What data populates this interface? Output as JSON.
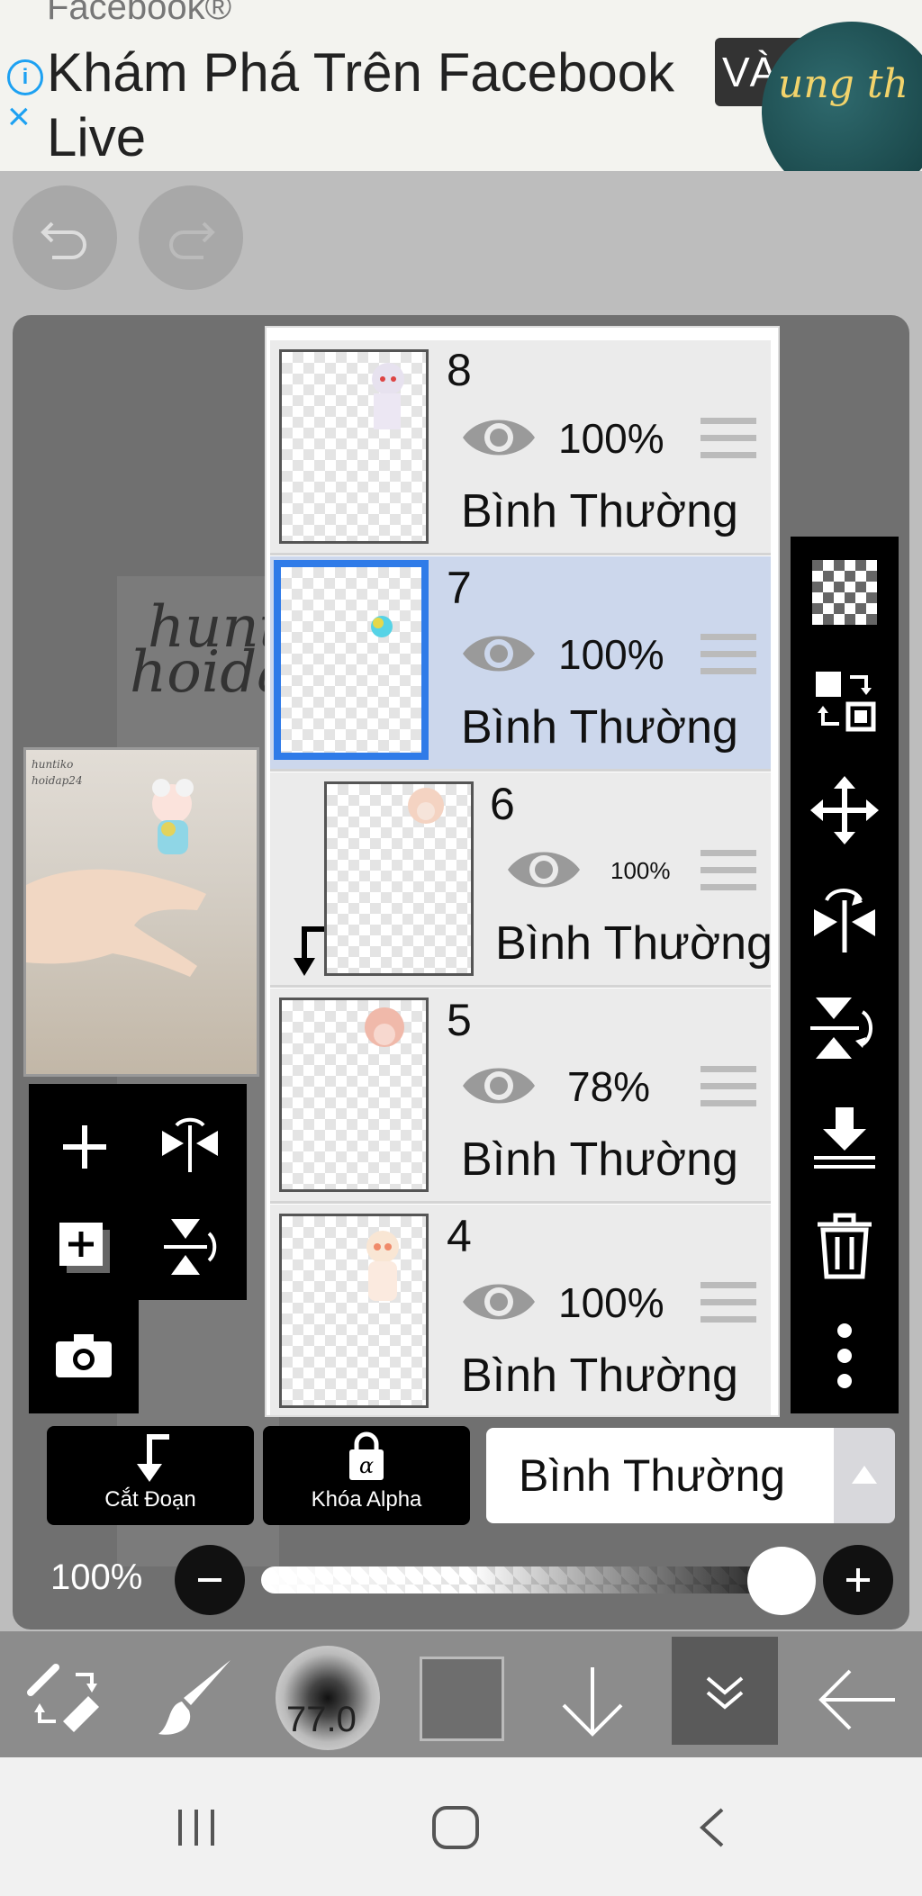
{
  "ad": {
    "brand": "Facebook®",
    "title": "Khám Phá Trên Facebook",
    "title_line2": "Live",
    "cta": "VÀ",
    "avatar_text": "ung th"
  },
  "toolbar": {
    "undo": "undo",
    "redo": "redo"
  },
  "watermark": {
    "line1": "huntiko",
    "line2": "hoidap24"
  },
  "layers": [
    {
      "number": "8",
      "opacity": "100%",
      "mode": "Bình Thường",
      "selected": false
    },
    {
      "number": "7",
      "opacity": "100%",
      "mode": "Bình Thường",
      "selected": true
    },
    {
      "number": "6",
      "opacity": "100%",
      "mode": "Bình Thường",
      "selected": false,
      "clipped": true
    },
    {
      "number": "5",
      "opacity": "78%",
      "mode": "Bình Thường",
      "selected": false
    },
    {
      "number": "4",
      "opacity": "100%",
      "mode": "Bình Thường",
      "selected": false
    }
  ],
  "controls": {
    "clip_label": "Cắt Đoạn",
    "alpha_lock_label": "Khóa Alpha",
    "blend_mode": "Bình Thường",
    "opacity_label": "100%",
    "opacity_value": 1.0
  },
  "bottom": {
    "brush_size": "77.0",
    "color": "#6e6e6e"
  },
  "icons": {
    "left_panel": [
      "plus-icon",
      "flip-horizontal-icon",
      "add-layer-icon",
      "flip-vertical-icon",
      "camera-icon"
    ],
    "right_panel": [
      "transparent-icon",
      "transform-icon",
      "move-icon",
      "flip-horizontal-icon",
      "flip-vertical-icon",
      "merge-down-icon",
      "trash-icon",
      "more-icon"
    ]
  },
  "colors": {
    "selected_layer": "#ccd7ec",
    "selected_border": "#2f7be8",
    "accent": "#1da1f2"
  }
}
